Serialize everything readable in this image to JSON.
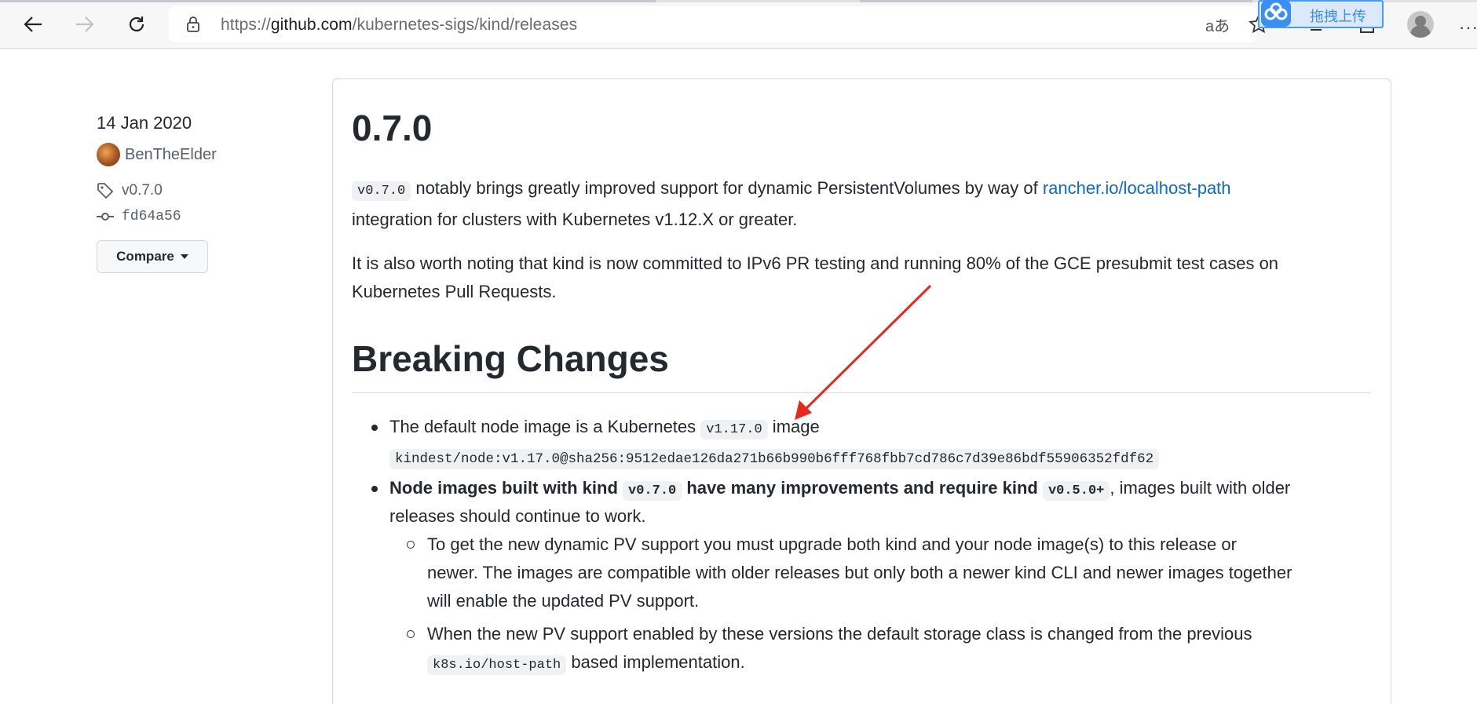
{
  "browser": {
    "url_prefix": "https://",
    "url_domain": "github.com",
    "url_path": "/kubernetes-sigs/kind/releases",
    "read_aloud_label": "aあ",
    "upload_badge_label": "拖拽上传",
    "more_label": "···"
  },
  "sidebar": {
    "date": "14 Jan 2020",
    "author": "BenTheElder",
    "tag": "v0.7.0",
    "commit": "fd64a56",
    "compare_label": "Compare"
  },
  "release": {
    "title": "0.7.0",
    "intro_code": "v0.7.0",
    "intro_text_1": " notably brings greatly improved support for dynamic PersistentVolumes by way of ",
    "intro_link": "rancher.io/localhost-path",
    "intro_text_2": "integration for clusters with Kubernetes v1.12.X or greater.",
    "ipv6_line_1": "It is also worth noting that kind is now committed to IPv6 PR testing and running 80% of the GCE presubmit test cases on",
    "ipv6_line_2": "Kubernetes Pull Requests.",
    "breaking_heading": "Breaking Changes",
    "b1_text": "The default node image is a Kubernetes ",
    "b1_code": "v1.17.0",
    "b1_tail": " image",
    "b1_image": "kindest/node:v1.17.0@sha256:9512edae126da271b66b990b6fff768fbb7cd786c7d39e86bdf55906352fdf62",
    "b2_bold_1": "Node images built with kind ",
    "b2_code_1": "v0.7.0",
    "b2_bold_2": " have many improvements and require kind ",
    "b2_code_2": "v0.5.0+",
    "b2_tail": ", images built with older",
    "b2_line_2": "releases should continue to work.",
    "s1_line_1": "To get the new dynamic PV support you must upgrade both kind and your node image(s) to this release or",
    "s1_line_2": "newer. The images are compatible with older releases but only both a newer kind CLI and newer images together",
    "s1_line_3": "will enable the updated PV support.",
    "s2_line_1": "When the new PV support enabled by these versions the default storage class is changed from the previous",
    "s2_code": "k8s.io/host-path",
    "s2_tail": " based implementation."
  },
  "colors": {
    "link": "#0969da",
    "annotation_arrow": "#e8281f"
  }
}
